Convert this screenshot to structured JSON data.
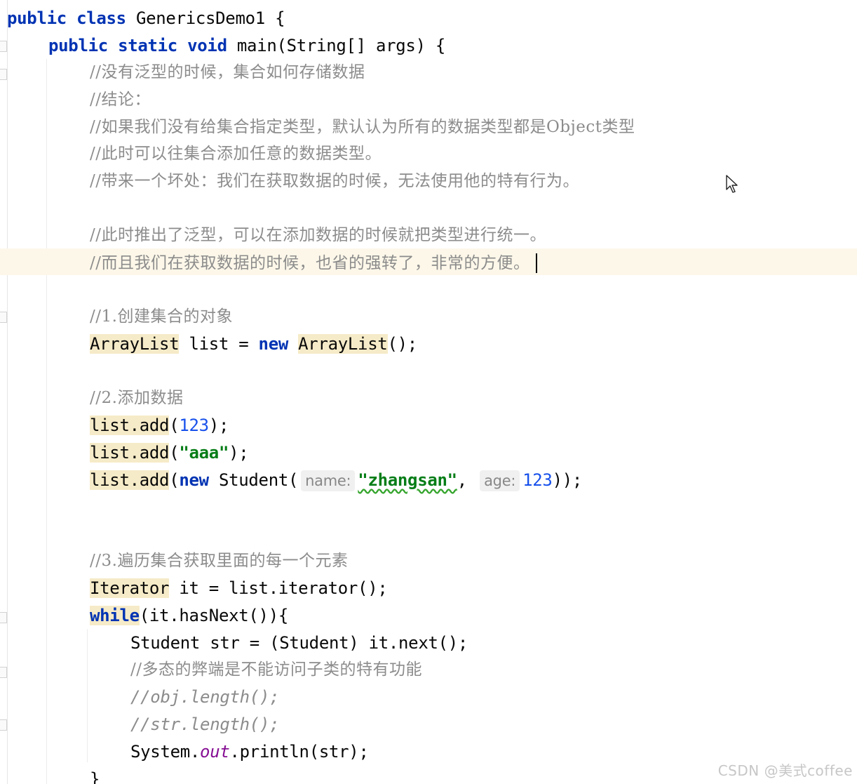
{
  "code": {
    "class_decl": {
      "kw1": "public",
      "kw2": "class",
      "name": "GenericsDemo1",
      "brace": " {"
    },
    "main_decl": {
      "kw1": "public",
      "kw2": "static",
      "kw3": "void",
      "rest": "main(String[] args) {"
    },
    "comments_block": [
      "//没有泛型的时候，集合如何存储数据",
      "//结论：",
      "//如果我们没有给集合指定类型，默认认为所有的数据类型都是Object类型",
      "//此时可以往集合添加任意的数据类型。",
      "//带来一个坏处：我们在获取数据的时候，无法使用他的特有行为。",
      "//此时推出了泛型，可以在添加数据的时候就把类型进行统一。",
      "//而且我们在获取数据的时候，也省的强转了，非常的方便。"
    ],
    "step1_comment": "//1.创建集合的对象",
    "arraylist_line": {
      "type": "ArrayList",
      "var": " list = ",
      "kw": "new",
      "space": " ",
      "ctor": "ArrayList",
      "end": "();"
    },
    "step2_comment": "//2.添加数据",
    "add1": {
      "call": "list.add",
      "open": "(",
      "arg": "123",
      "close": ");"
    },
    "add2": {
      "call": "list.add",
      "open": "(",
      "arg": "\"aaa\"",
      "close": ");"
    },
    "add3": {
      "call": "list.add",
      "open": "(",
      "kw": "new",
      "ctor": " Student(",
      "hint1": "name:",
      "arg1": "\"zhangsan\"",
      "comma": ", ",
      "hint2": "age:",
      "arg2": "123",
      "close": "));"
    },
    "step3_comment": "//3.遍历集合获取里面的每一个元素",
    "iterator_line": {
      "type": "Iterator",
      "rest": " it = list.iterator();"
    },
    "while_line": {
      "kw": "while",
      "rest": "(it.hasNext()){"
    },
    "student_line": "Student str = (Student) it.next();",
    "poly_comment": "//多态的弊端是不能访问子类的特有功能",
    "obj_comment": "//obj.length();",
    "str_comment": "//str.length();",
    "print_line": {
      "pre": "System.",
      "field": "out",
      "post": ".println(str);"
    },
    "close_brace": "}"
  },
  "watermark": "CSDN @美式coffee",
  "colors": {
    "keyword": "#0033b3",
    "comment": "#8c8c8c",
    "number": "#1750eb",
    "string": "#067d17",
    "type_highlight": "#f6ebc8",
    "current_line": "#fcf7e9"
  },
  "icons": {
    "cursor": "mouse-pointer-icon"
  }
}
